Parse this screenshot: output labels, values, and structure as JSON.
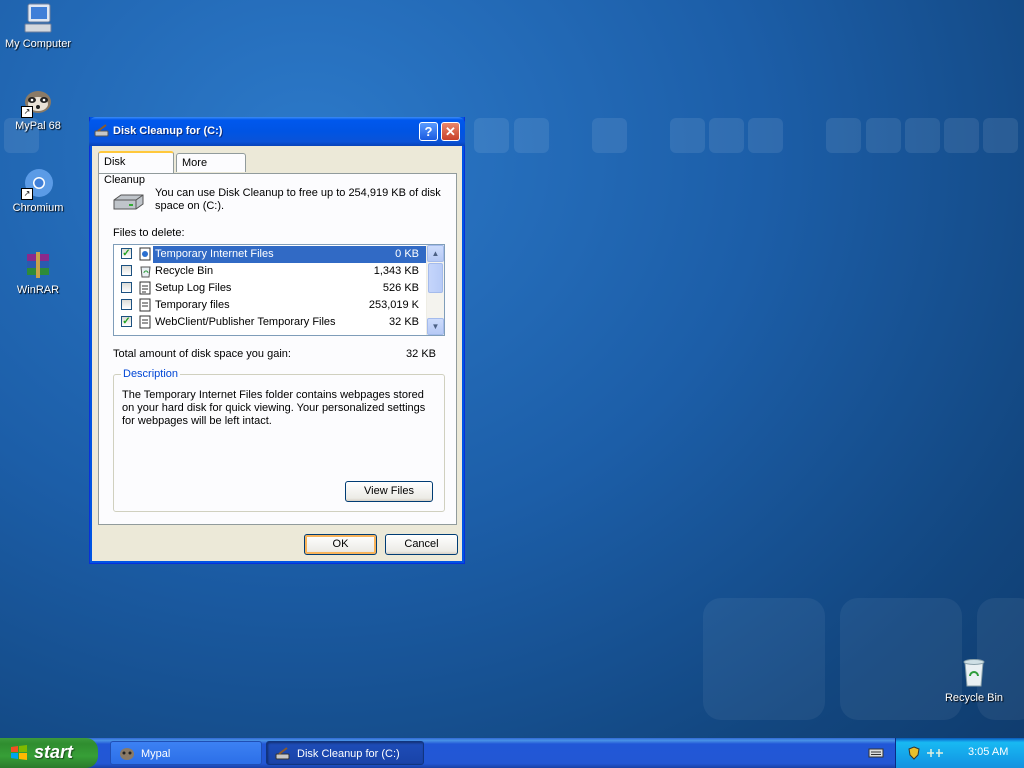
{
  "desktop": {
    "icons": [
      {
        "label": "My Computer",
        "icon": "my-computer-icon"
      },
      {
        "label": "MyPal 68",
        "icon": "mypal-icon"
      },
      {
        "label": "Chromium",
        "icon": "chromium-icon"
      },
      {
        "label": "WinRAR",
        "icon": "winrar-icon"
      },
      {
        "label": "Recycle Bin",
        "icon": "recycle-bin-icon"
      }
    ]
  },
  "dialog": {
    "title": "Disk Cleanup for  (C:)",
    "help_btn": "?",
    "close_btn": "✕",
    "tabs": [
      "Disk Cleanup",
      "More Options"
    ],
    "intro": "You can use Disk Cleanup to free up to 254,919 KB of disk space on  (C:).",
    "files_label": "Files to delete:",
    "files": [
      {
        "name": "Temporary Internet Files",
        "size": "0 KB",
        "checked": true,
        "selected": true
      },
      {
        "name": "Recycle Bin",
        "size": "1,343 KB",
        "checked": false,
        "selected": false
      },
      {
        "name": "Setup Log Files",
        "size": "526 KB",
        "checked": false,
        "selected": false
      },
      {
        "name": "Temporary files",
        "size": "253,019 K",
        "checked": false,
        "selected": false
      },
      {
        "name": "WebClient/Publisher Temporary Files",
        "size": "32 KB",
        "checked": true,
        "selected": false
      }
    ],
    "total_label": "Total amount of disk space you gain:",
    "total_value": "32 KB",
    "description_title": "Description",
    "description_text": "The Temporary Internet Files folder contains webpages stored on your hard disk for quick viewing. Your personalized settings for webpages will be left intact.",
    "view_files": "View Files",
    "ok": "OK",
    "cancel": "Cancel"
  },
  "taskbar": {
    "start": "start",
    "items": [
      {
        "label": "Mypal",
        "active": false
      },
      {
        "label": "Disk Cleanup for  (C:)",
        "active": true
      }
    ],
    "clock": "3:05 AM"
  }
}
